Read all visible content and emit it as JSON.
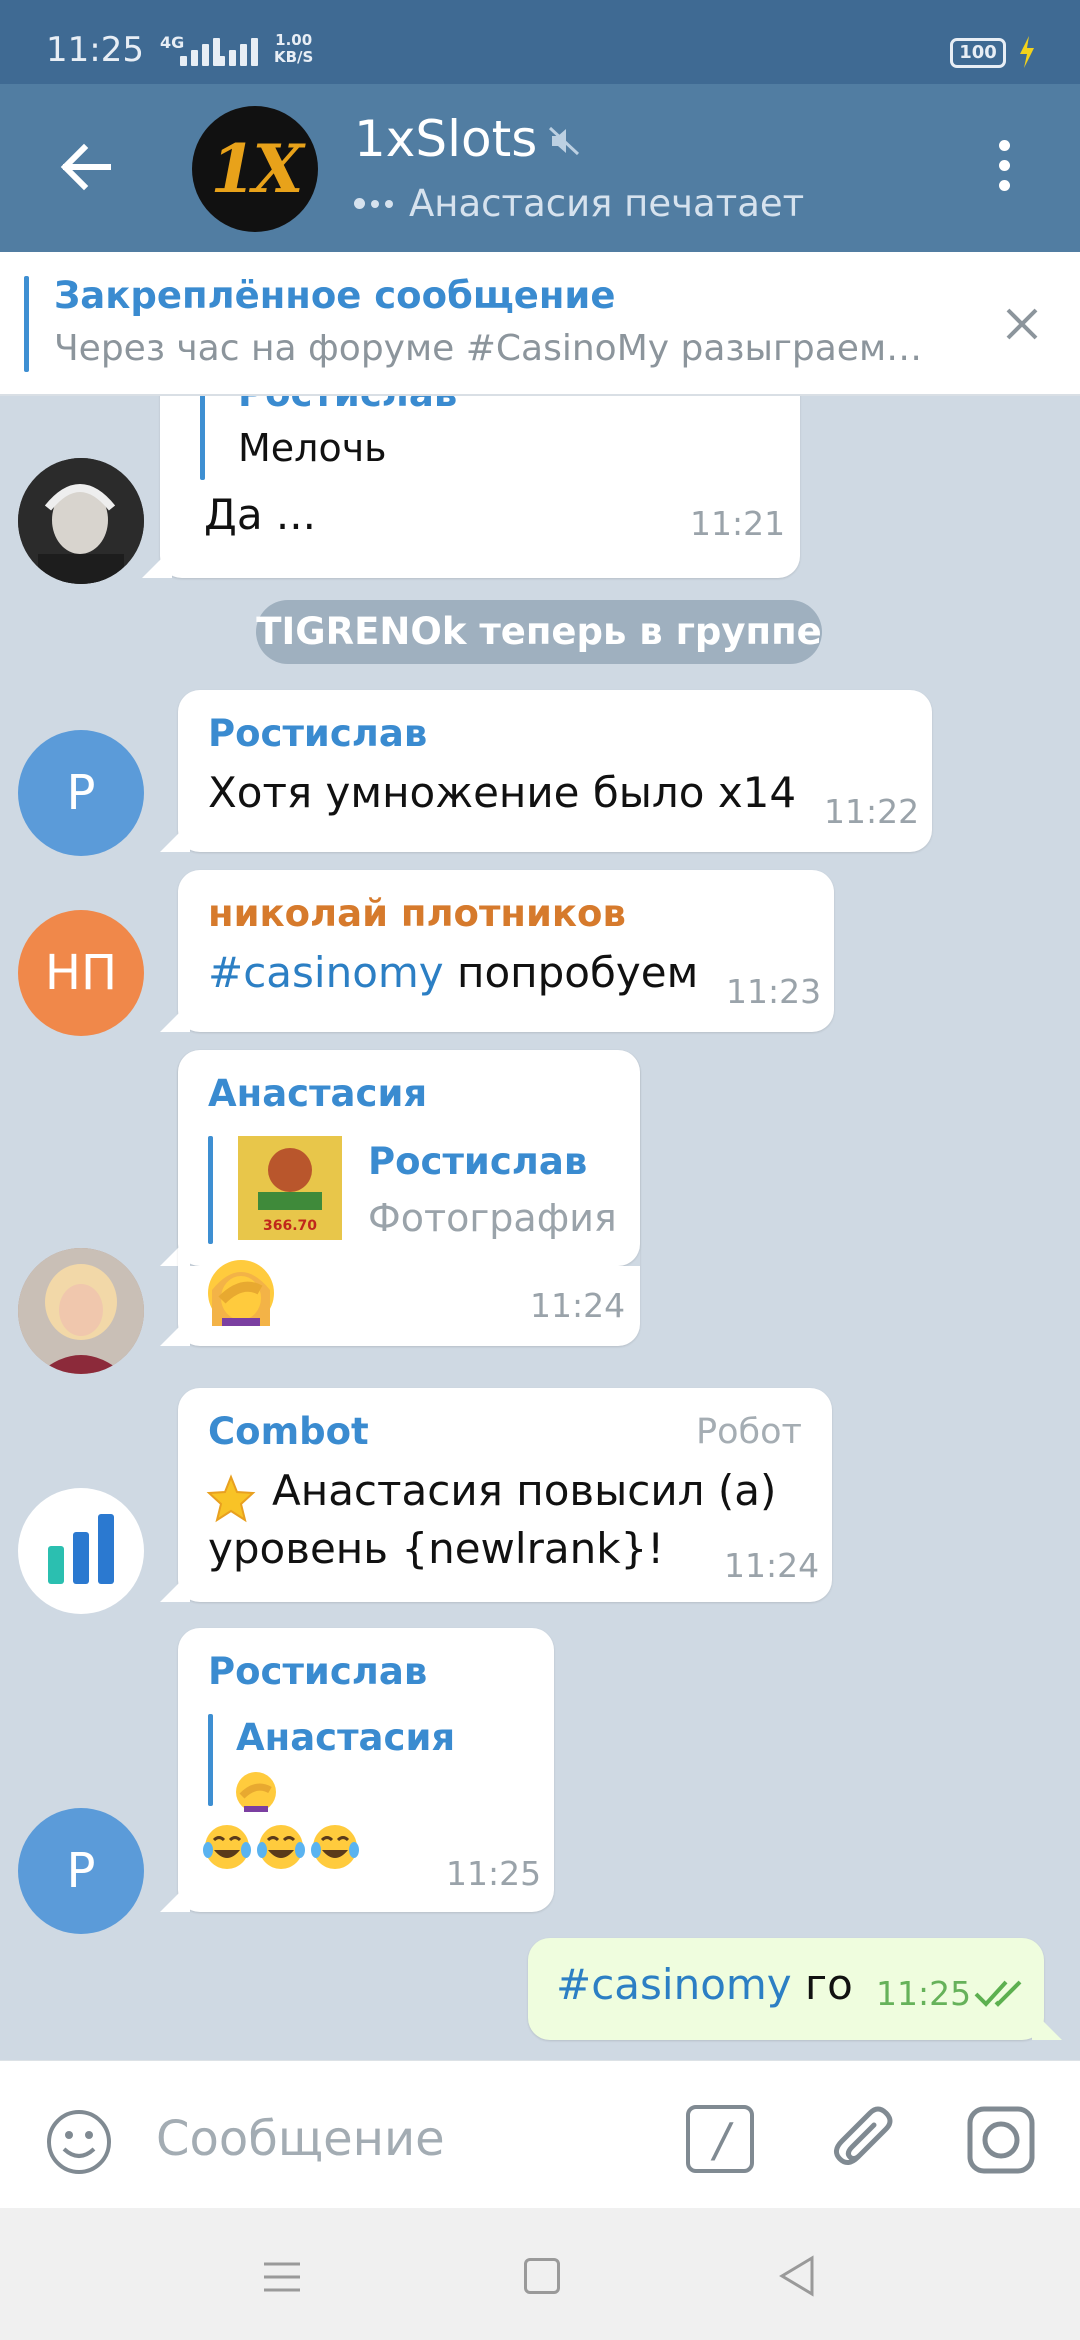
{
  "status_bar": {
    "time": "11:25",
    "network": "4G",
    "speed_value": "1.00",
    "speed_unit": "KB/S",
    "battery": "100"
  },
  "header": {
    "title": "1xSlots",
    "avatar_logo": "1X",
    "typing_text": "Анастасия печатает",
    "muted": true
  },
  "pinned": {
    "title": "Закреплённое сообщение",
    "text": "Через час на форуме #CasinoMy разыграем…"
  },
  "system_message": "TIGRENOk теперь в группе",
  "messages": [
    {
      "reply_name": "Ростислав",
      "reply_text": "Мелочь",
      "text": "Да ...",
      "time": "11:21"
    },
    {
      "sender": "Ростислав",
      "avatar_initial": "Р",
      "text": "Хотя умножение было х14",
      "time": "11:22"
    },
    {
      "sender": "николай плотников",
      "avatar_initial": "НП",
      "hashtag": "#casinomy",
      "text": " попробуем",
      "time": "11:23"
    },
    {
      "sender": "Анастасия",
      "reply_name": "Ростислав",
      "reply_text": "Фотография",
      "photo_caption": "366.70",
      "time": "11:24"
    },
    {
      "sender": "Combot",
      "badge": "Робот",
      "line1": "Анастасия повысил (а)",
      "line2": "уровень {newlrank}!",
      "time": "11:24"
    },
    {
      "sender": "Ростислав",
      "avatar_initial": "Р",
      "reply_name": "Анастасия",
      "time": "11:25"
    },
    {
      "hashtag": "#casinomy",
      "text": " го",
      "time": "11:25",
      "outgoing": true
    }
  ],
  "input": {
    "placeholder": "Сообщение"
  },
  "colors": {
    "header": "#517da2",
    "status": "#3f6a93",
    "chat_bg": "#cfd9e3",
    "link": "#2c7fc4",
    "name_blue": "#3a8bd0",
    "name_orange": "#d67a2c",
    "outgoing": "#effdde"
  },
  "icons": [
    "back-arrow-icon",
    "mute-icon",
    "more-vert-icon",
    "close-icon",
    "smile-icon",
    "slash-command-icon",
    "paperclip-icon",
    "camera-icon",
    "double-check-icon",
    "star-icon"
  ]
}
